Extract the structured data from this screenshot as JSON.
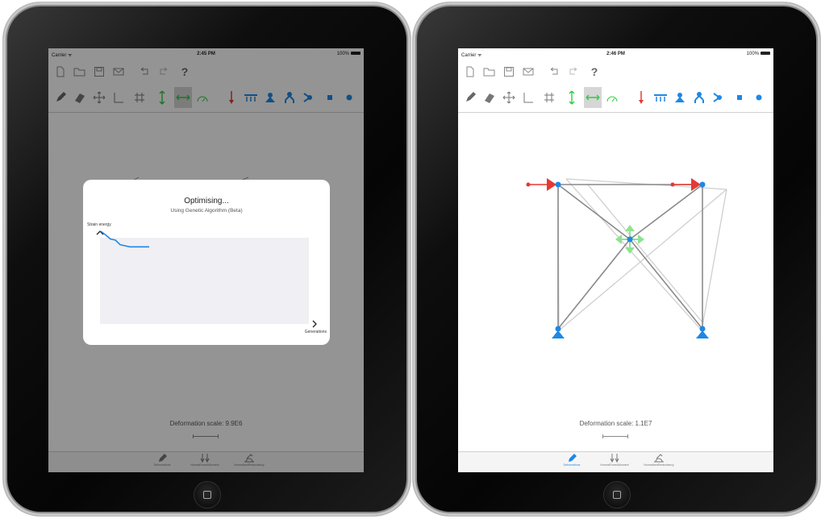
{
  "left_device": {
    "status": {
      "carrier": "Carrier ᯤ",
      "time": "2:45 PM",
      "battery": "100%"
    },
    "file_tools": [
      "new-doc-icon",
      "open-folder-icon",
      "save-icon",
      "mail-icon",
      "undo-icon",
      "redo-icon",
      "help-icon"
    ],
    "help_glyph": "?",
    "deformation_label": "Deformation scale: 9.9E6",
    "tabs": [
      {
        "label": "Deformations",
        "icon": "pencil-icon",
        "active": false
      },
      {
        "label": "NormalForce&Moment",
        "icon": "force-icon",
        "active": false
      },
      {
        "label": "NormalizedRedundancy",
        "icon": "redundancy-icon",
        "active": false
      }
    ],
    "modal": {
      "title": "Optimising...",
      "subtitle": "Using Genetic Algorithm (Beta)",
      "y_axis_label": "Strain energy",
      "x_axis_label": "Generations"
    }
  },
  "right_device": {
    "status": {
      "carrier": "Carrier ᯤ",
      "time": "2:46 PM",
      "battery": "100%"
    },
    "help_glyph": "?",
    "deformation_label": "Deformation scale: 1.1E7",
    "tabs": [
      {
        "label": "Deformations",
        "icon": "pencil-icon",
        "active": true
      },
      {
        "label": "NormalForce&Moment",
        "icon": "force-icon",
        "active": false
      },
      {
        "label": "NormalizedRedundancy",
        "icon": "redundancy-icon",
        "active": false
      }
    ]
  },
  "colors": {
    "accent_blue": "#1e88e5",
    "load_red": "#e53935",
    "constraint_green": "#2ecc40",
    "member_gray": "#8a8a8a",
    "ghost_gray": "#cfcfcf"
  },
  "chart_data": {
    "type": "line",
    "title": "",
    "ylabel": "Strain energy",
    "xlabel": "Generations",
    "series": [
      {
        "values": [
          1.0,
          0.93,
          0.85,
          0.83,
          0.74,
          0.72,
          0.7,
          0.7,
          0.7,
          0.7,
          0.7
        ]
      }
    ],
    "grid": false
  }
}
